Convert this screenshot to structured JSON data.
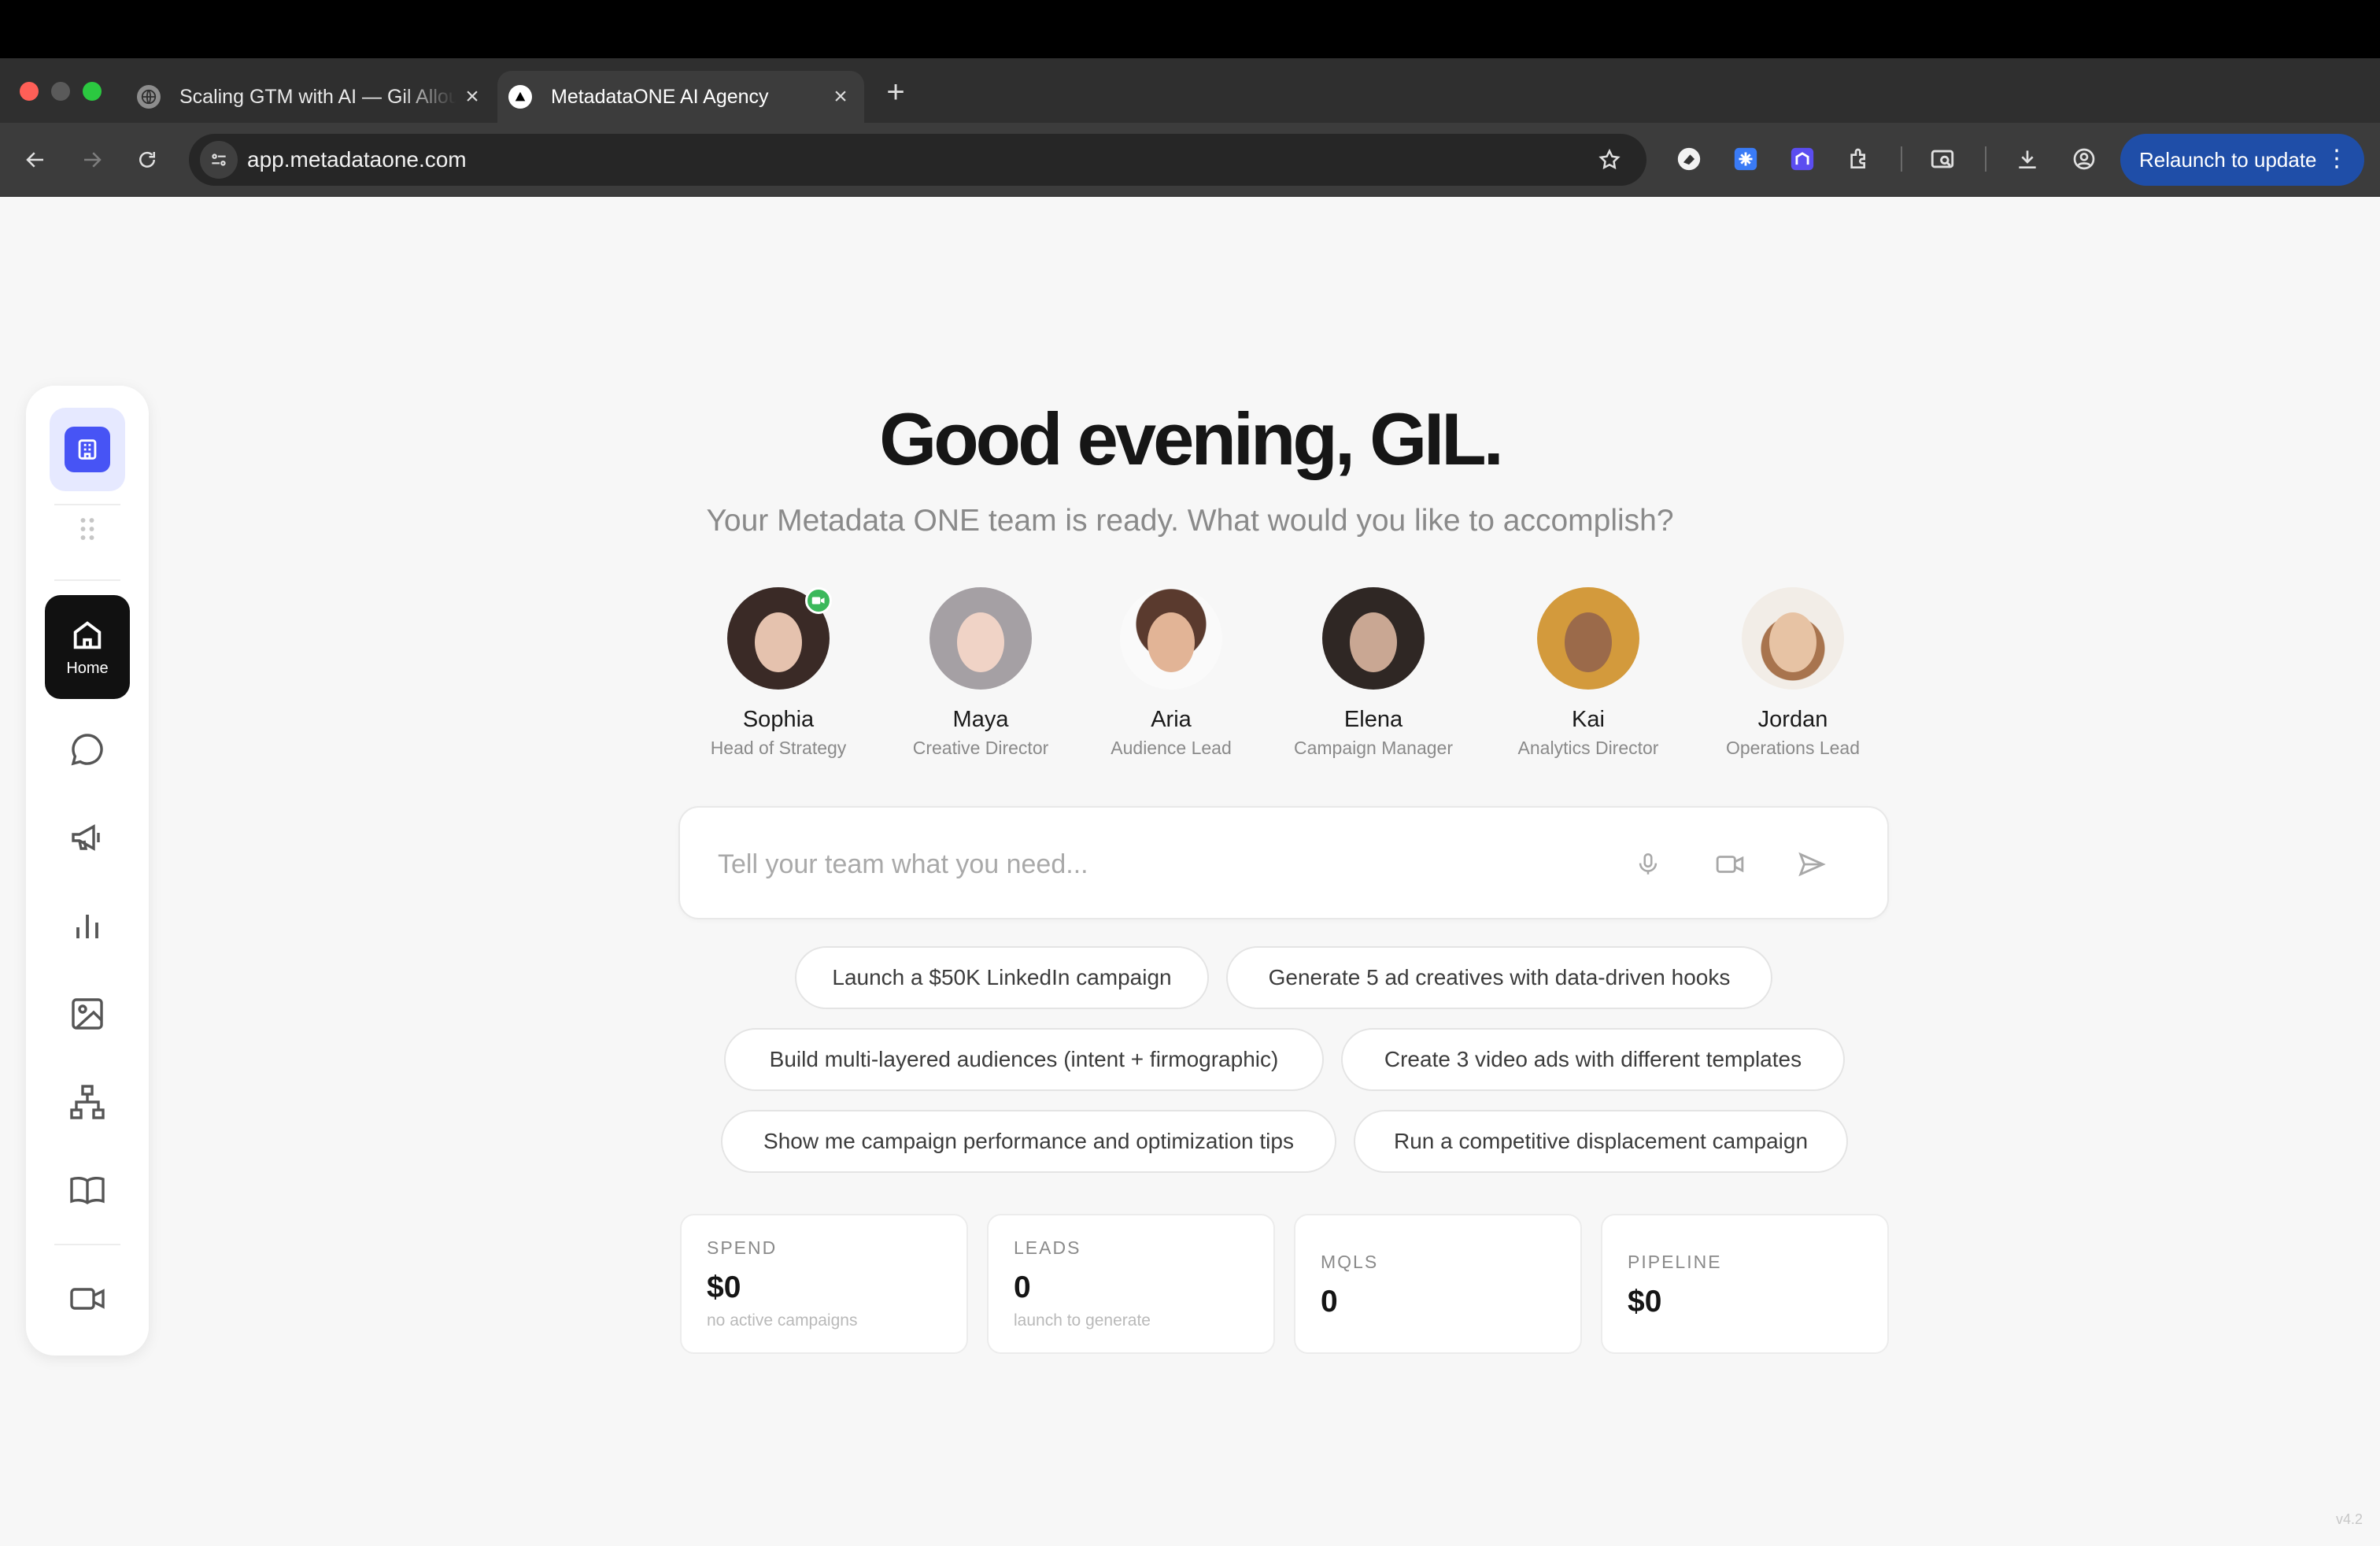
{
  "browser": {
    "tabs": [
      {
        "title": "Scaling GTM with AI — Gil Allouche",
        "active": false
      },
      {
        "title": "MetadataONE AI Agency",
        "active": true
      }
    ],
    "url": "app.metadataone.com",
    "relaunch_label": "Relaunch to update"
  },
  "sidebar": {
    "home_label": "Home",
    "items": [
      "chat-icon",
      "megaphone-icon",
      "bar-chart-icon",
      "image-icon",
      "org-chart-icon",
      "book-icon",
      "video-icon"
    ]
  },
  "main": {
    "greeting": "Good evening, GIL.",
    "subtitle": "Your Metadata ONE team is ready. What would you like to accomplish?",
    "team": [
      {
        "name": "Sophia",
        "role": "Head of Strategy",
        "live": true
      },
      {
        "name": "Maya",
        "role": "Creative Director",
        "live": false
      },
      {
        "name": "Aria",
        "role": "Audience Lead",
        "live": false
      },
      {
        "name": "Elena",
        "role": "Campaign Manager",
        "live": false
      },
      {
        "name": "Kai",
        "role": "Analytics Director",
        "live": false
      },
      {
        "name": "Jordan",
        "role": "Operations Lead",
        "live": false
      }
    ],
    "prompt_placeholder": "Tell your team what you need...",
    "suggestions": [
      "Launch a $50K LinkedIn campaign",
      "Generate 5 ad creatives with data-driven hooks",
      "Build multi-layered audiences (intent + firmographic)",
      "Create 3 video ads with different templates",
      "Show me campaign performance and optimization tips",
      "Run a competitive displacement campaign"
    ],
    "stats": [
      {
        "label": "SPEND",
        "value": "$0",
        "sub": "no active campaigns"
      },
      {
        "label": "LEADS",
        "value": "0",
        "sub": "launch to generate"
      },
      {
        "label": "MQLS",
        "value": "0",
        "sub": ""
      },
      {
        "label": "PIPELINE",
        "value": "$0",
        "sub": ""
      }
    ]
  },
  "footer": {
    "version": "v4.2"
  },
  "colors": {
    "accent": "#4754f5",
    "live": "#3bb85b",
    "relaunch": "#1f4ea8"
  }
}
